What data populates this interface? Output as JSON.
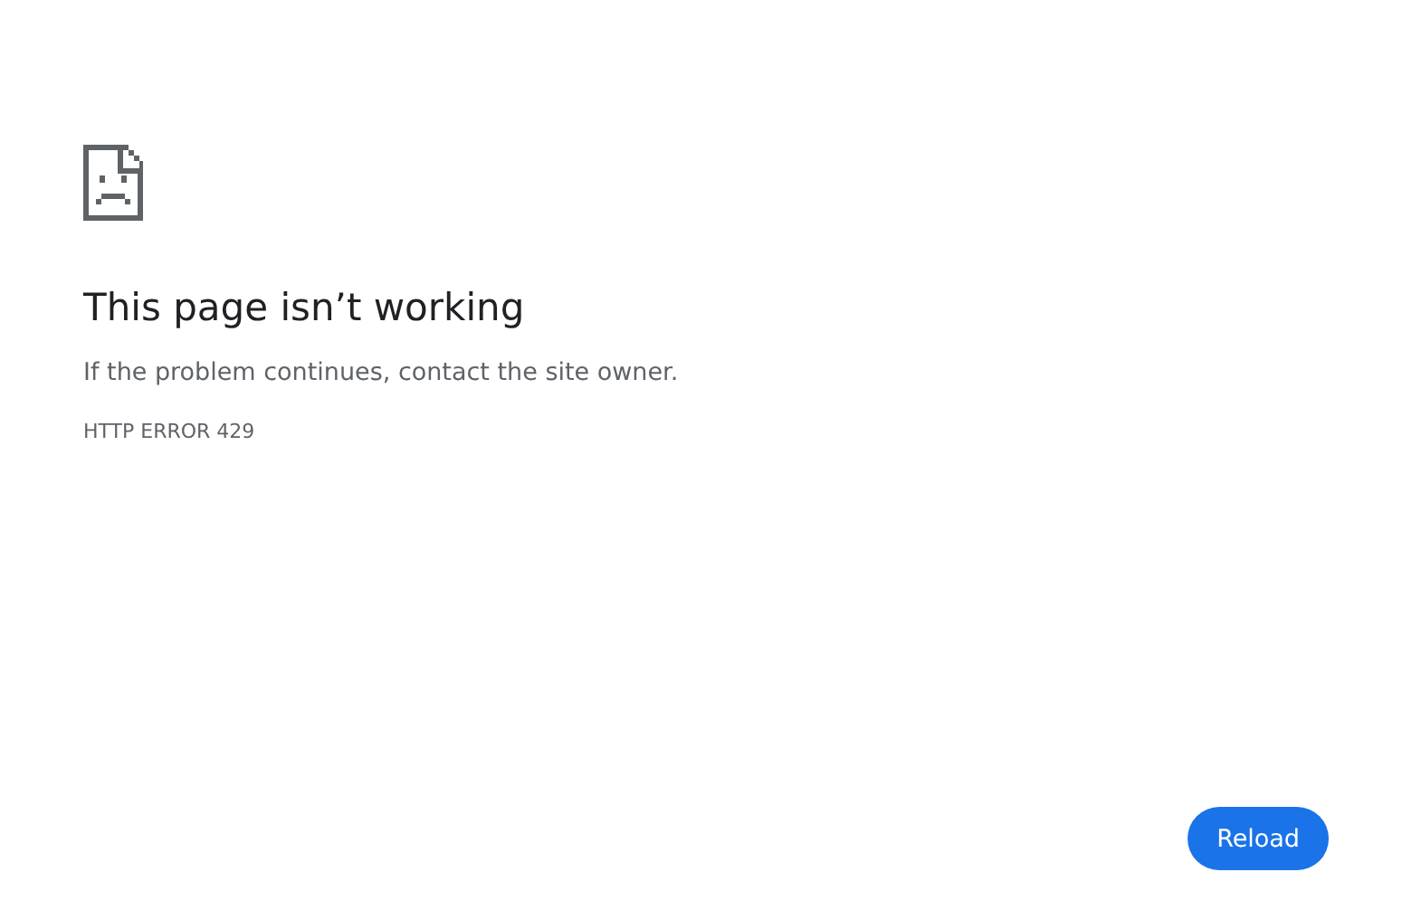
{
  "title": "This page isn’t working",
  "message": "If the problem continues, contact the site owner.",
  "error_code": "HTTP ERROR 429",
  "buttons": [
    {
      "label": "Reload"
    }
  ]
}
